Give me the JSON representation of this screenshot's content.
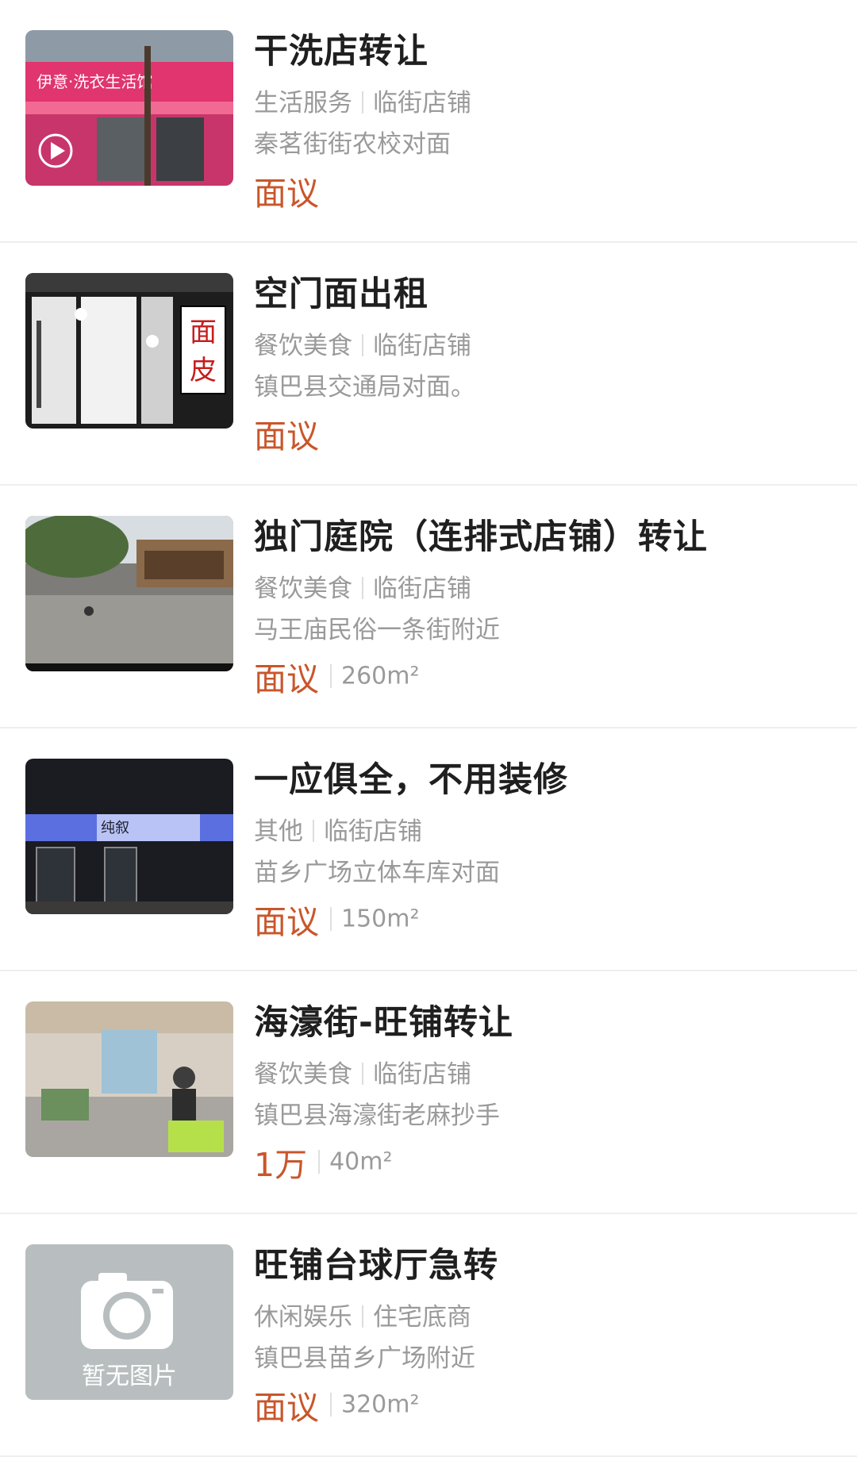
{
  "listings": [
    {
      "title": "干洗店转让",
      "category": "生活服务",
      "type": "临街店铺",
      "address": "秦茗街街农校对面",
      "price": "面议",
      "area": "",
      "thumb": "drycleaner",
      "has_video": true,
      "sign_text": "伊意·洗衣生活馆"
    },
    {
      "title": "空门面出租",
      "category": "餐饮美食",
      "type": "临街店铺",
      "address": "镇巴县交通局对面。",
      "price": "面议",
      "area": "",
      "thumb": "storefront",
      "sign_text": "面皮"
    },
    {
      "title": "独门庭院（连排式店铺）转让",
      "category": "餐饮美食",
      "type": "临街店铺",
      "address": "马王庙民俗一条街附近",
      "price": "面议",
      "area": "260m²",
      "thumb": "courtyard"
    },
    {
      "title": "一应俱全，不用装修",
      "category": "其他",
      "type": "临街店铺",
      "address": "苗乡广场立体车库对面",
      "price": "面议",
      "area": "150m²",
      "thumb": "nightsign",
      "sign_text": "纯叙"
    },
    {
      "title": "海濠街-旺铺转让",
      "category": "餐饮美食",
      "type": "临街店铺",
      "address": "镇巴县海濠街老麻抄手",
      "price": "1万",
      "area": "40m²",
      "thumb": "restaurant"
    },
    {
      "title": "旺铺台球厅急转",
      "category": "休闲娱乐",
      "type": "住宅底商",
      "address": "镇巴县苗乡广场附近",
      "price": "面议",
      "area": "320m²",
      "thumb": "placeholder",
      "placeholder_text": "暂无图片"
    }
  ],
  "colors": {
    "price": "#c9562a",
    "title": "#1f1f1f",
    "meta": "#9a9a9a",
    "divider": "#eeeeee"
  }
}
